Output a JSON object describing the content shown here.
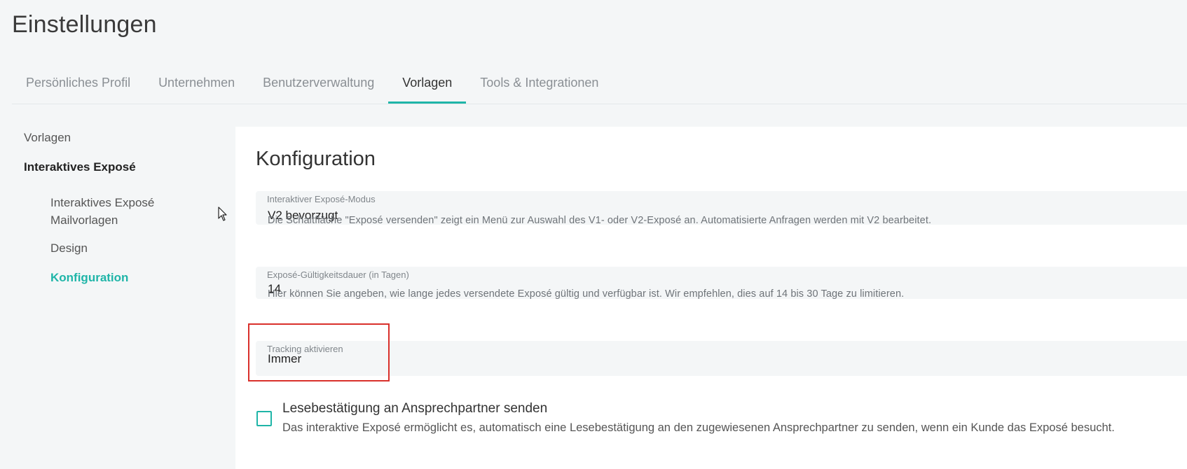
{
  "page": {
    "title": "Einstellungen"
  },
  "tabs": [
    {
      "label": "Persönliches Profil",
      "active": false
    },
    {
      "label": "Unternehmen",
      "active": false
    },
    {
      "label": "Benutzerverwaltung",
      "active": false
    },
    {
      "label": "Vorlagen",
      "active": true
    },
    {
      "label": "Tools & Integrationen",
      "active": false
    }
  ],
  "sidebar": {
    "items": [
      {
        "label": "Vorlagen"
      },
      {
        "label": "Interaktives Exposé"
      },
      {
        "label": "Interaktives Exposé Mailvorlagen"
      },
      {
        "label": "Design"
      },
      {
        "label": "Konfiguration"
      }
    ]
  },
  "main": {
    "title": "Konfiguration",
    "fields": [
      {
        "label": "Interaktiver Exposé-Modus",
        "value": "V2 bevorzugt",
        "hint": "Die Schaltfläche \"Exposé versenden\" zeigt ein Menü zur Auswahl des V1- oder V2-Exposé an. Automatisierte Anfragen werden mit V2 bearbeitet."
      },
      {
        "label": "Exposé-Gültigkeitsdauer (in Tagen)",
        "value": "14",
        "hint": "Hier können Sie angeben, wie lange jedes versendete Exposé gültig und verfügbar ist. Wir empfehlen, dies auf 14 bis 30 Tage zu limitieren."
      },
      {
        "label": "Tracking aktivieren",
        "value": "Immer"
      }
    ],
    "checkbox": {
      "title": "Lesebestätigung an Ansprechpartner senden",
      "description": "Das interaktive Exposé ermöglicht es, automatisch eine Lesebestätigung an den zugewiesenen Ansprechpartner zu senden, wenn ein Kunde das Exposé besucht.",
      "checked": false
    }
  },
  "colors": {
    "accent": "#1fb5a8",
    "highlight": "#d9302b",
    "background": "#f4f6f7"
  }
}
